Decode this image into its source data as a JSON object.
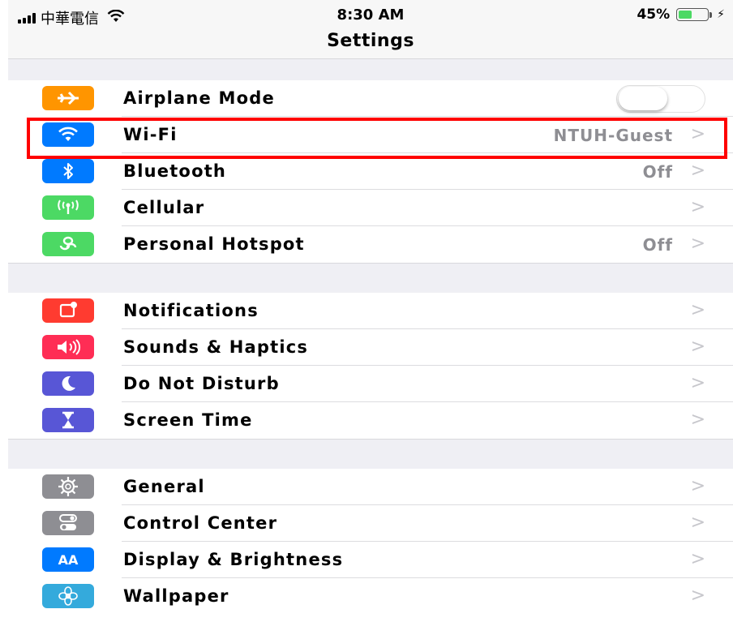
{
  "status_bar": {
    "carrier": "中華電信",
    "time": "8:30 AM",
    "battery": "45%",
    "battery_level": 0.45
  },
  "nav": {
    "title": "Settings"
  },
  "groups": [
    {
      "rows": [
        {
          "label": "Airplane Mode",
          "icon": "airplane-icon",
          "color": "#ff9500",
          "toggle": false
        },
        {
          "label": "Wi-Fi",
          "icon": "wifi-icon",
          "color": "#007aff",
          "value": "NTUH-Guest",
          "highlighted": true
        },
        {
          "label": "Bluetooth",
          "icon": "bluetooth-icon",
          "color": "#007aff",
          "value": "Off"
        },
        {
          "label": "Cellular",
          "icon": "cellular-icon",
          "color": "#4cd964"
        },
        {
          "label": "Personal Hotspot",
          "icon": "hotspot-icon",
          "color": "#4cd964",
          "value": "Off"
        }
      ]
    },
    {
      "rows": [
        {
          "label": "Notifications",
          "icon": "notifications-icon",
          "color": "#ff3b30"
        },
        {
          "label": "Sounds & Haptics",
          "icon": "speaker-icon",
          "color": "#ff2d55"
        },
        {
          "label": "Do Not Disturb",
          "icon": "moon-icon",
          "color": "#5856d6"
        },
        {
          "label": "Screen Time",
          "icon": "hourglass-icon",
          "color": "#5856d6"
        }
      ]
    },
    {
      "rows": [
        {
          "label": "General",
          "icon": "gear-icon",
          "color": "#8e8e93"
        },
        {
          "label": "Control Center",
          "icon": "control-center-icon",
          "color": "#8e8e93"
        },
        {
          "label": "Display & Brightness",
          "icon": "display-icon",
          "color": "#007aff",
          "glyph": "AA"
        },
        {
          "label": "Wallpaper",
          "icon": "wallpaper-icon",
          "color": "#34aadc"
        }
      ]
    }
  ]
}
